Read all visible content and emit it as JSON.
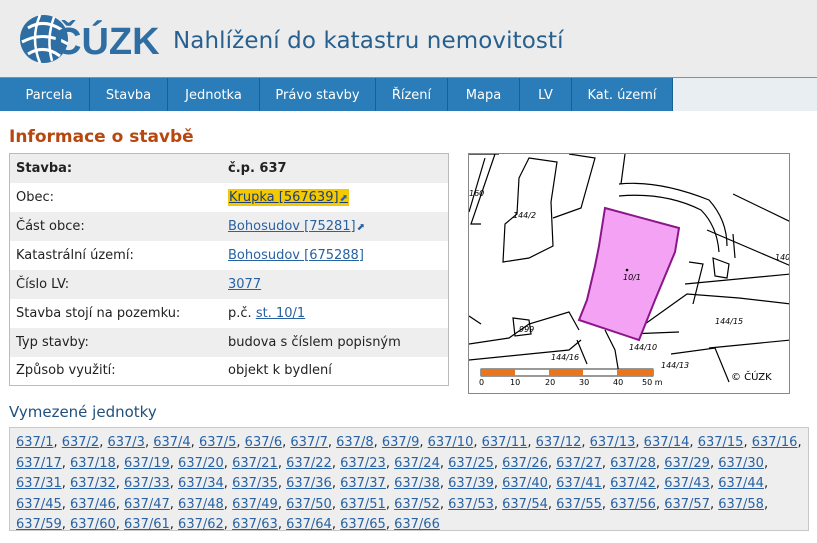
{
  "header": {
    "logo_text": "ČÚZK",
    "title": "Nahlížení do katastru nemovitostí"
  },
  "nav": {
    "items": [
      {
        "label": "Parcela"
      },
      {
        "label": "Stavba"
      },
      {
        "label": "Jednotka"
      },
      {
        "label": "Právo stavby"
      },
      {
        "label": "Řízení"
      },
      {
        "label": "Mapa"
      },
      {
        "label": "LV"
      },
      {
        "label": "Kat. území"
      }
    ]
  },
  "info": {
    "title": "Informace o stavbě",
    "rows": [
      {
        "key": "Stavba:",
        "value": "č.p. 637"
      },
      {
        "key": "Obec:",
        "value": "Krupka [567639]"
      },
      {
        "key": "Část obce:",
        "value": "Bohosudov [75281]"
      },
      {
        "key": "Katastrální území:",
        "value": "Bohosudov [675288]"
      },
      {
        "key": "Číslo LV:",
        "value": "3077"
      },
      {
        "key": "Stavba stojí na pozemku:",
        "value_prefix": "p.č. ",
        "value": "st. 10/1"
      },
      {
        "key": "Typ stavby:",
        "value": "budova s číslem popisným"
      },
      {
        "key": "Způsob využití:",
        "value": "objekt k bydlení"
      }
    ]
  },
  "map": {
    "parcel_labels": [
      "160",
      "144/2",
      "10/1",
      "140/",
      "999",
      "144/15",
      "144/16",
      "144/10",
      "144/13"
    ],
    "scale_labels": [
      "0",
      "10",
      "20",
      "30",
      "40",
      "50 m"
    ],
    "copyright": "© ČÚZK",
    "colors": {
      "building": "#f4a3f4",
      "building_border": "#8a168a",
      "scale_orange": "#e8761e"
    }
  },
  "units": {
    "title": "Vymezené jednotky",
    "items": [
      "637/1",
      "637/2",
      "637/3",
      "637/4",
      "637/5",
      "637/6",
      "637/7",
      "637/8",
      "637/9",
      "637/10",
      "637/11",
      "637/12",
      "637/13",
      "637/14",
      "637/15",
      "637/16",
      "637/17",
      "637/18",
      "637/19",
      "637/20",
      "637/21",
      "637/22",
      "637/23",
      "637/24",
      "637/25",
      "637/26",
      "637/27",
      "637/28",
      "637/29",
      "637/30",
      "637/31",
      "637/32",
      "637/33",
      "637/34",
      "637/35",
      "637/36",
      "637/37",
      "637/38",
      "637/39",
      "637/40",
      "637/41",
      "637/42",
      "637/43",
      "637/44",
      "637/45",
      "637/46",
      "637/47",
      "637/48",
      "637/49",
      "637/50",
      "637/51",
      "637/52",
      "637/53",
      "637/54",
      "637/55",
      "637/56",
      "637/57",
      "637/58",
      "637/59",
      "637/60",
      "637/61",
      "637/62",
      "637/63",
      "637/64",
      "637/65",
      "637/66"
    ]
  }
}
